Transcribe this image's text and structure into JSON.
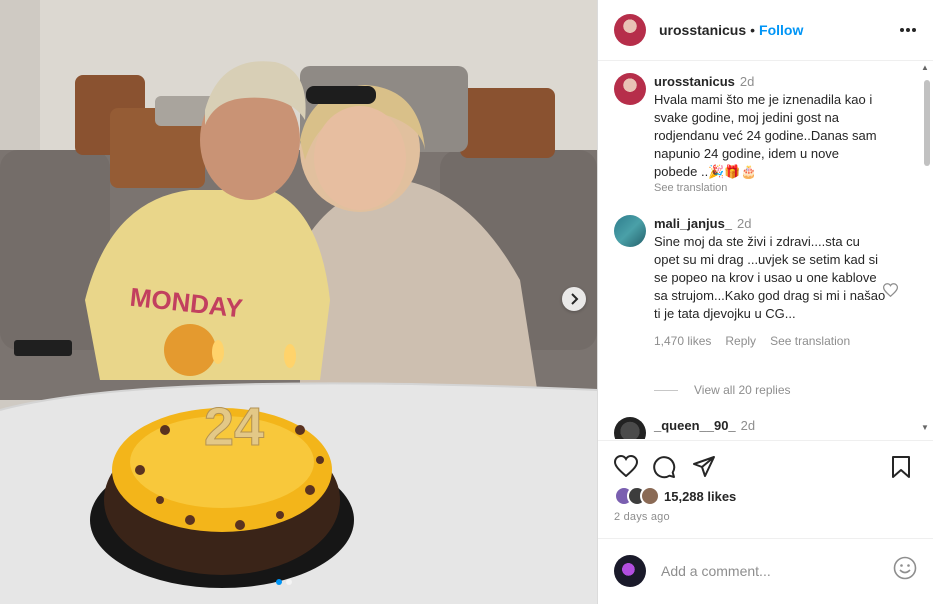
{
  "post": {
    "username": "urosstanicus",
    "separator": "•",
    "follow_label": "Follow"
  },
  "comments": [
    {
      "username": "urosstanicus",
      "time": "2d",
      "text": "Hvala mami što me je iznenadila kao i svake godine, moj jedini gost na rodjendanu već 24 godine..Danas sam napunio 24 godine, idem u nove pobede ..🎉🎁🎂",
      "translation": "See translation"
    },
    {
      "username": "mali_janjus_",
      "time": "2d",
      "text": "Sine moj da ste živi i zdravi....sta cu opet su mi drag ...uvjek se setim kad si se popeo na krov i usao u one kablove sa strujom...Kako god drag si mi i našao ti je tata djevojku u CG...",
      "likes": "1,470 likes",
      "reply_label": "Reply",
      "translation": "See translation",
      "view_replies": "View all 20 replies"
    },
    {
      "username": "_queen__90_",
      "time": "2d"
    }
  ],
  "photo": {
    "shirt_text": "MONDAY",
    "candle_number": "24"
  },
  "footer": {
    "likes": "15,288 likes",
    "date": "2 days ago",
    "comment_placeholder": "Add a comment..."
  },
  "icons": {
    "like": "heart-icon",
    "comment": "comment-icon",
    "share": "share-icon",
    "save": "bookmark-icon",
    "more": "more-icon",
    "emoji": "emoji-icon",
    "next": "chevron-right-icon"
  },
  "colors": {
    "link_blue": "#0095f6",
    "text": "#262626",
    "muted": "#8e8e8e"
  }
}
